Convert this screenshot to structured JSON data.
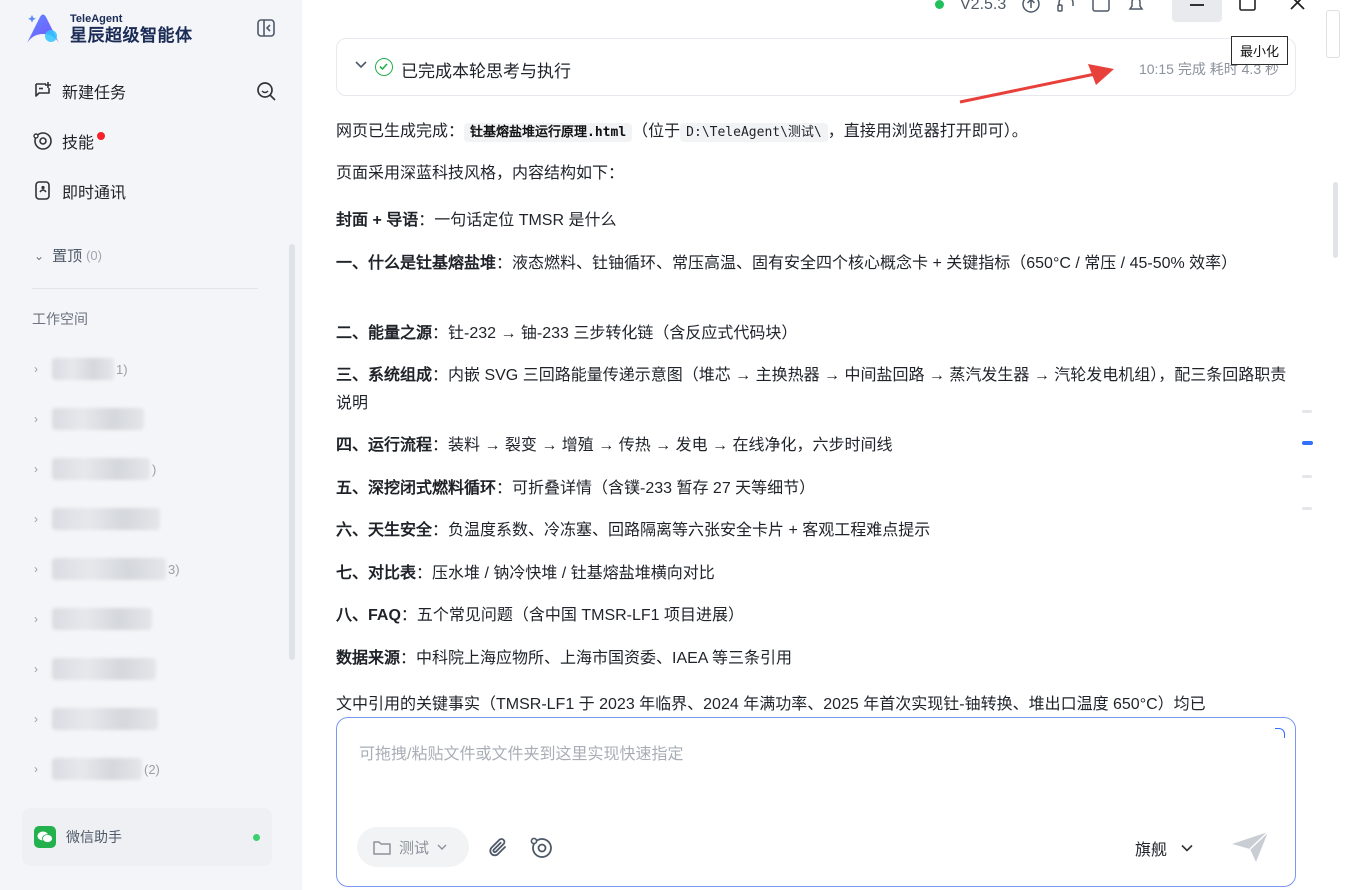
{
  "brand": {
    "name_en": "TeleAgent",
    "name_cn": "星辰超级智能体"
  },
  "sidebar": {
    "new_task": "新建任务",
    "skills": "技能",
    "im": "即时通讯",
    "pinned": {
      "label": "置顶",
      "count": "(0)"
    },
    "workspace_title": "工作空间",
    "workspace_items": [
      {
        "tail": "1)"
      },
      {
        "tail": ""
      },
      {
        "tail": ")"
      },
      {
        "tail": ""
      },
      {
        "tail": "3)"
      },
      {
        "tail": ""
      },
      {
        "tail": ""
      },
      {
        "tail": ""
      },
      {
        "tail": "(2)"
      }
    ],
    "wechat": "微信助手"
  },
  "topbar": {
    "version": "V2.5.3",
    "tooltip": "最小化"
  },
  "status_card": {
    "text": "已完成本轮思考与执行",
    "time": "10:15 完成 耗时 4.3 秒"
  },
  "content": {
    "line1_prefix": "网页已生成完成：",
    "file_name": "钍基熔盐堆运行原理.html",
    "line1_mid": "（位于",
    "path": "D:\\TeleAgent\\测试\\",
    "line1_suffix": "，直接用浏览器打开即可）。",
    "line2": "页面采用深蓝科技风格，内容结构如下：",
    "sections": [
      {
        "head": "封面 + 导语",
        "body": "：一句话定位 TMSR 是什么"
      },
      {
        "head": "一、什么是钍基熔盐堆",
        "body": "：液态燃料、钍铀循环、常压高温、固有安全四个核心概念卡 + 关键指标（650°C / 常压 / 45-50% 效率）"
      },
      {
        "head": "二、能量之源",
        "body": "：钍-232 → 铀-233 三步转化链（含反应式代码块）"
      },
      {
        "head": "三、系统组成",
        "body": "：内嵌 SVG 三回路能量传递示意图（堆芯 → 主换热器 → 中间盐回路 → 蒸汽发生器 → 汽轮发电机组），配三条回路职责说明"
      },
      {
        "head": "四、运行流程",
        "body": "：装料 → 裂变 → 增殖 → 传热 → 发电 → 在线净化，六步时间线"
      },
      {
        "head": "五、深挖闭式燃料循环",
        "body": "：可折叠详情（含镤-233 暂存 27 天等细节）"
      },
      {
        "head": "六、天生安全",
        "body": "：负温度系数、冷冻塞、回路隔离等六张安全卡片 + 客观工程难点提示"
      },
      {
        "head": "七、对比表",
        "body": "：压水堆 / 钠冷快堆 / 钍基熔盐堆横向对比"
      },
      {
        "head": "八、FAQ",
        "body": "：五个常见问题（含中国 TMSR-LF1 项目进展）"
      },
      {
        "head": "数据来源",
        "body": "：中科院上海应物所、上海市国资委、IAEA 等三条引用"
      }
    ],
    "last_line": "文中引用的关键事实（TMSR-LF1 于 2023 年临界、2024 年满功率、2025 年首次实现钍-铀转换、堆出口温度 650°C）均已"
  },
  "input": {
    "placeholder": "可拖拽/粘贴文件或文件夹到这里实现快速指定",
    "folder": "测试",
    "model": "旗舰"
  },
  "colors": {
    "accent": "#3370ff",
    "success": "#22b14c",
    "annotation": "#e8403a"
  }
}
